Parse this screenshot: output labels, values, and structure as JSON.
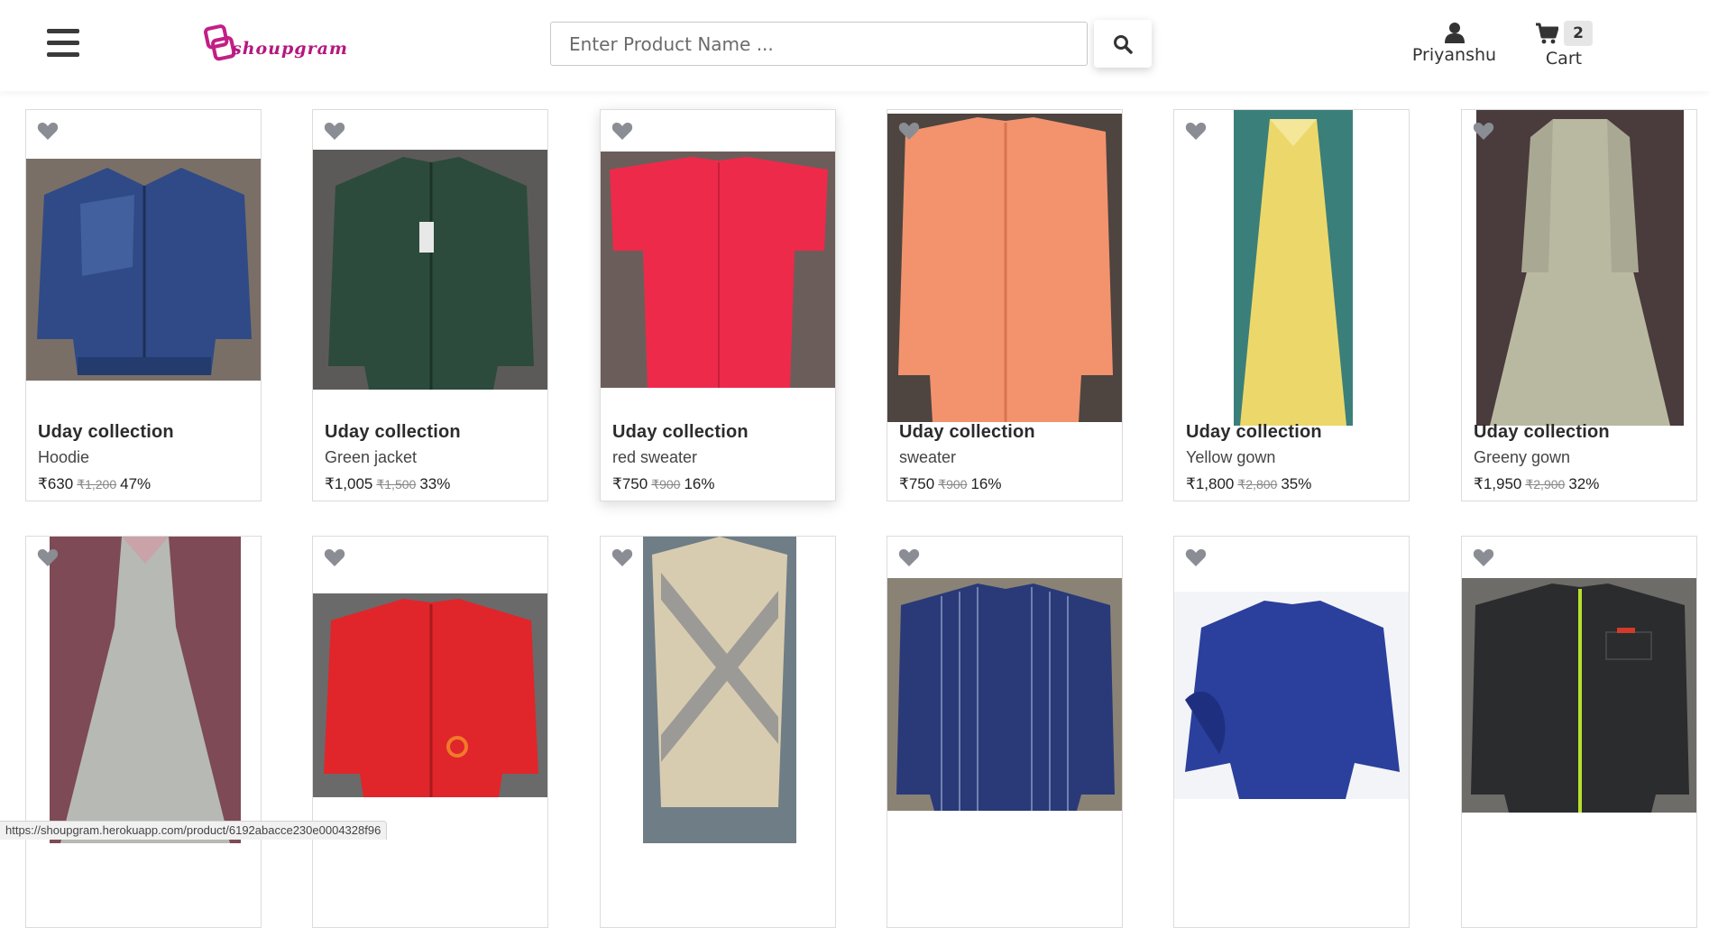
{
  "header": {
    "logo_text": "shoupgram",
    "search_placeholder": "Enter Product Name ...",
    "user_label": "Priyanshu",
    "cart_label": "Cart",
    "cart_count": "2"
  },
  "currency": "₹",
  "products": [
    {
      "brand": "Uday collection",
      "name": "Hoodie",
      "price": "₹630",
      "old_price": "₹1,200",
      "discount": "47%",
      "color": "#2f4a86"
    },
    {
      "brand": "Uday collection",
      "name": "Green jacket",
      "price": "₹1,005",
      "old_price": "₹1,500",
      "discount": "33%",
      "color": "#2c4b3c"
    },
    {
      "brand": "Uday collection",
      "name": "red sweater",
      "price": "₹750",
      "old_price": "₹900",
      "discount": "16%",
      "color": "#ee2a4a"
    },
    {
      "brand": "Uday collection",
      "name": "sweater",
      "price": "₹750",
      "old_price": "₹900",
      "discount": "16%",
      "color": "#f2936e"
    },
    {
      "brand": "Uday collection",
      "name": "Yellow gown",
      "price": "₹1,800",
      "old_price": "₹2,800",
      "discount": "35%",
      "color": "#ecd86a"
    },
    {
      "brand": "Uday collection",
      "name": "Greeny gown",
      "price": "₹1,950",
      "old_price": "₹2,900",
      "discount": "32%",
      "color": "#b9b9a2"
    },
    {
      "color": "#b6b9b4"
    },
    {
      "color": "#e0262a"
    },
    {
      "color": "#d8ccb0"
    },
    {
      "color": "#2a3a78"
    },
    {
      "color": "#2b3f9c"
    },
    {
      "color": "#2a2c2e"
    }
  ],
  "status_url": "https://shoupgram.herokuapp.com/product/6192abacce230e0004328f96"
}
